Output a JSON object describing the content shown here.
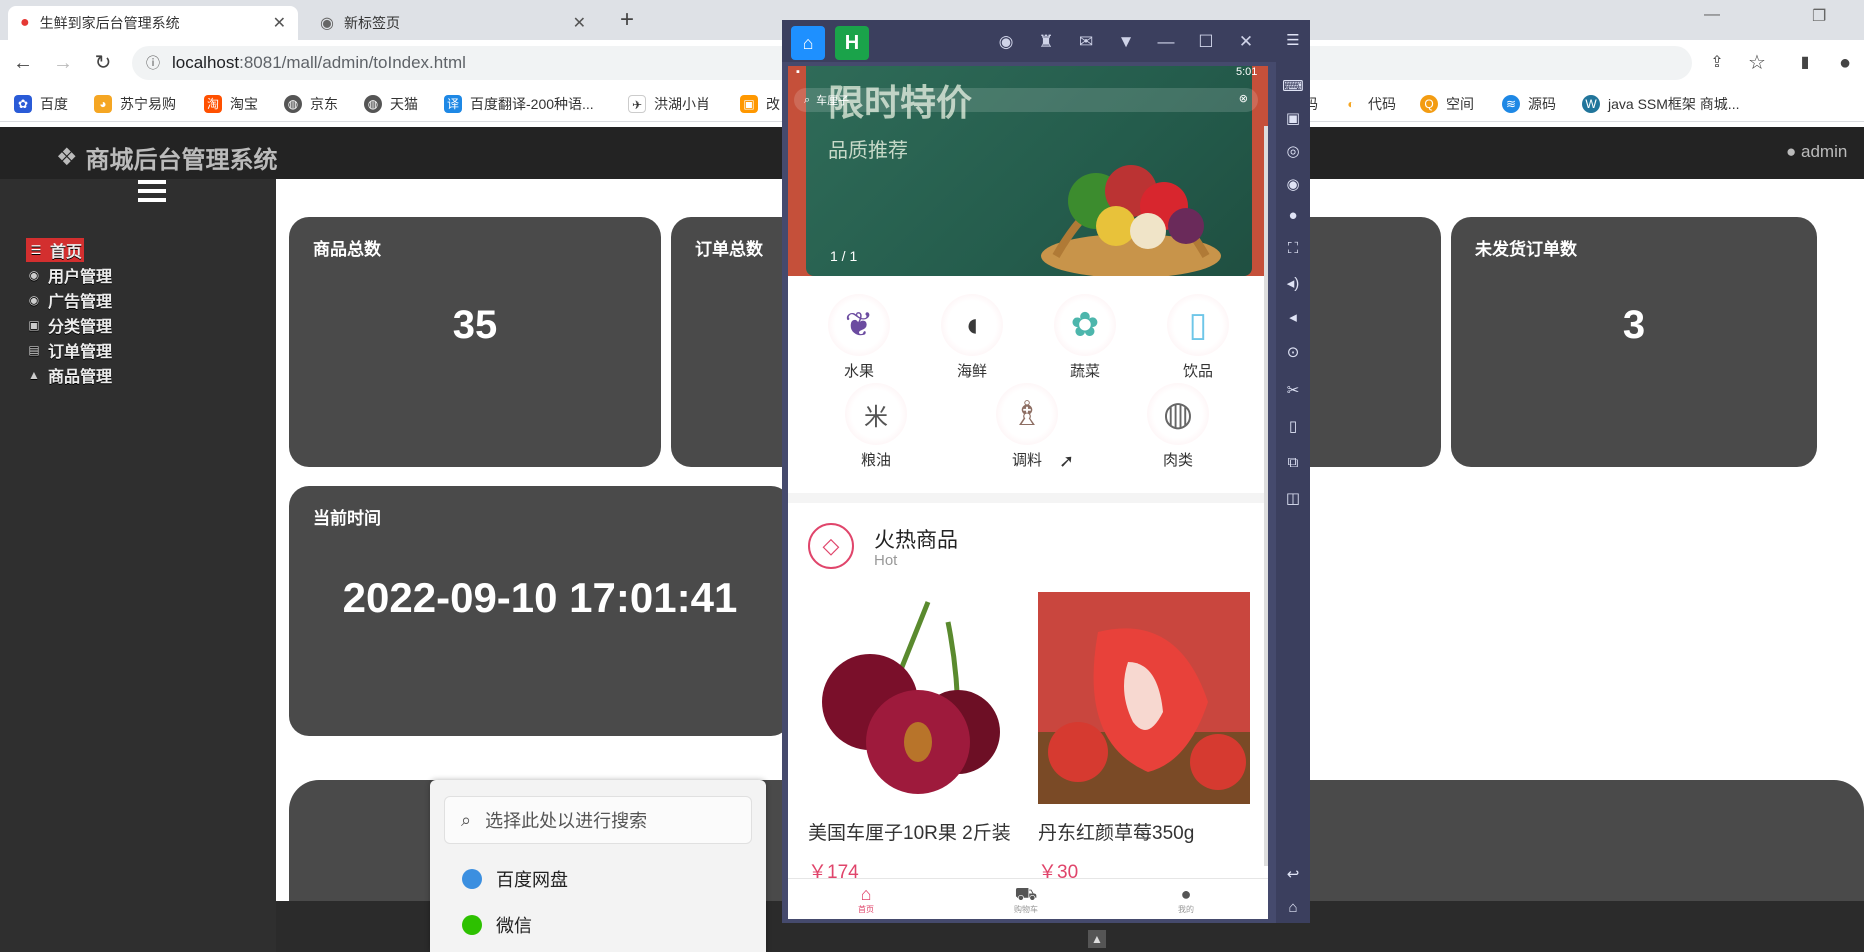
{
  "browser": {
    "tabs": [
      {
        "title": "生鲜到家后台管理系统",
        "active": true
      },
      {
        "title": "新标签页",
        "active": false
      }
    ],
    "url_host": "localhost",
    "url_rest": ":8081/mall/admin/toIndex.html",
    "bookmarks": [
      "百度",
      "苏宁易购",
      "淘宝",
      "京东",
      "天猫",
      "百度翻译-200种语...",
      "洪湖小肖",
      "改",
      "码",
      "代码",
      "空间",
      "源码",
      "java SSM框架 商城..."
    ]
  },
  "app": {
    "brand": "商城后台管理系统",
    "user": "admin",
    "menu": [
      "首页",
      "用户管理",
      "广告管理",
      "分类管理",
      "订单管理",
      "商品管理"
    ],
    "cards": {
      "goods_total": {
        "title": "商品总数",
        "value": "35"
      },
      "order_total": {
        "title": "订单总数"
      },
      "unshipped": {
        "title": "未发货订单数",
        "value": "3"
      },
      "current_time": {
        "title": "当前时间",
        "value": "2022-09-10 17:01:41"
      }
    }
  },
  "search_popup": {
    "placeholder": "选择此处以进行搜索",
    "items": [
      "百度网盘",
      "微信"
    ]
  },
  "phone": {
    "status_time": "5:01",
    "search_text": "车厘子",
    "banner_title": "限时特价",
    "banner_subtitle": "品质推荐",
    "banner_pager": "1 / 1",
    "categories": [
      "水果",
      "海鲜",
      "蔬菜",
      "饮品",
      "粮油",
      "调料",
      "肉类"
    ],
    "section_title": "火热商品",
    "section_sub": "Hot",
    "products": [
      {
        "name": "美国车厘子10R果 2斤装",
        "price": "￥174"
      },
      {
        "name": "丹东红颜草莓350g",
        "price": "￥30"
      }
    ],
    "tabbar": [
      "首页",
      "购物车",
      "我的"
    ]
  },
  "colors": {
    "accent_red": "#d32f2f",
    "price_pink": "#e0456b",
    "card_gray": "#4a4a4a"
  }
}
